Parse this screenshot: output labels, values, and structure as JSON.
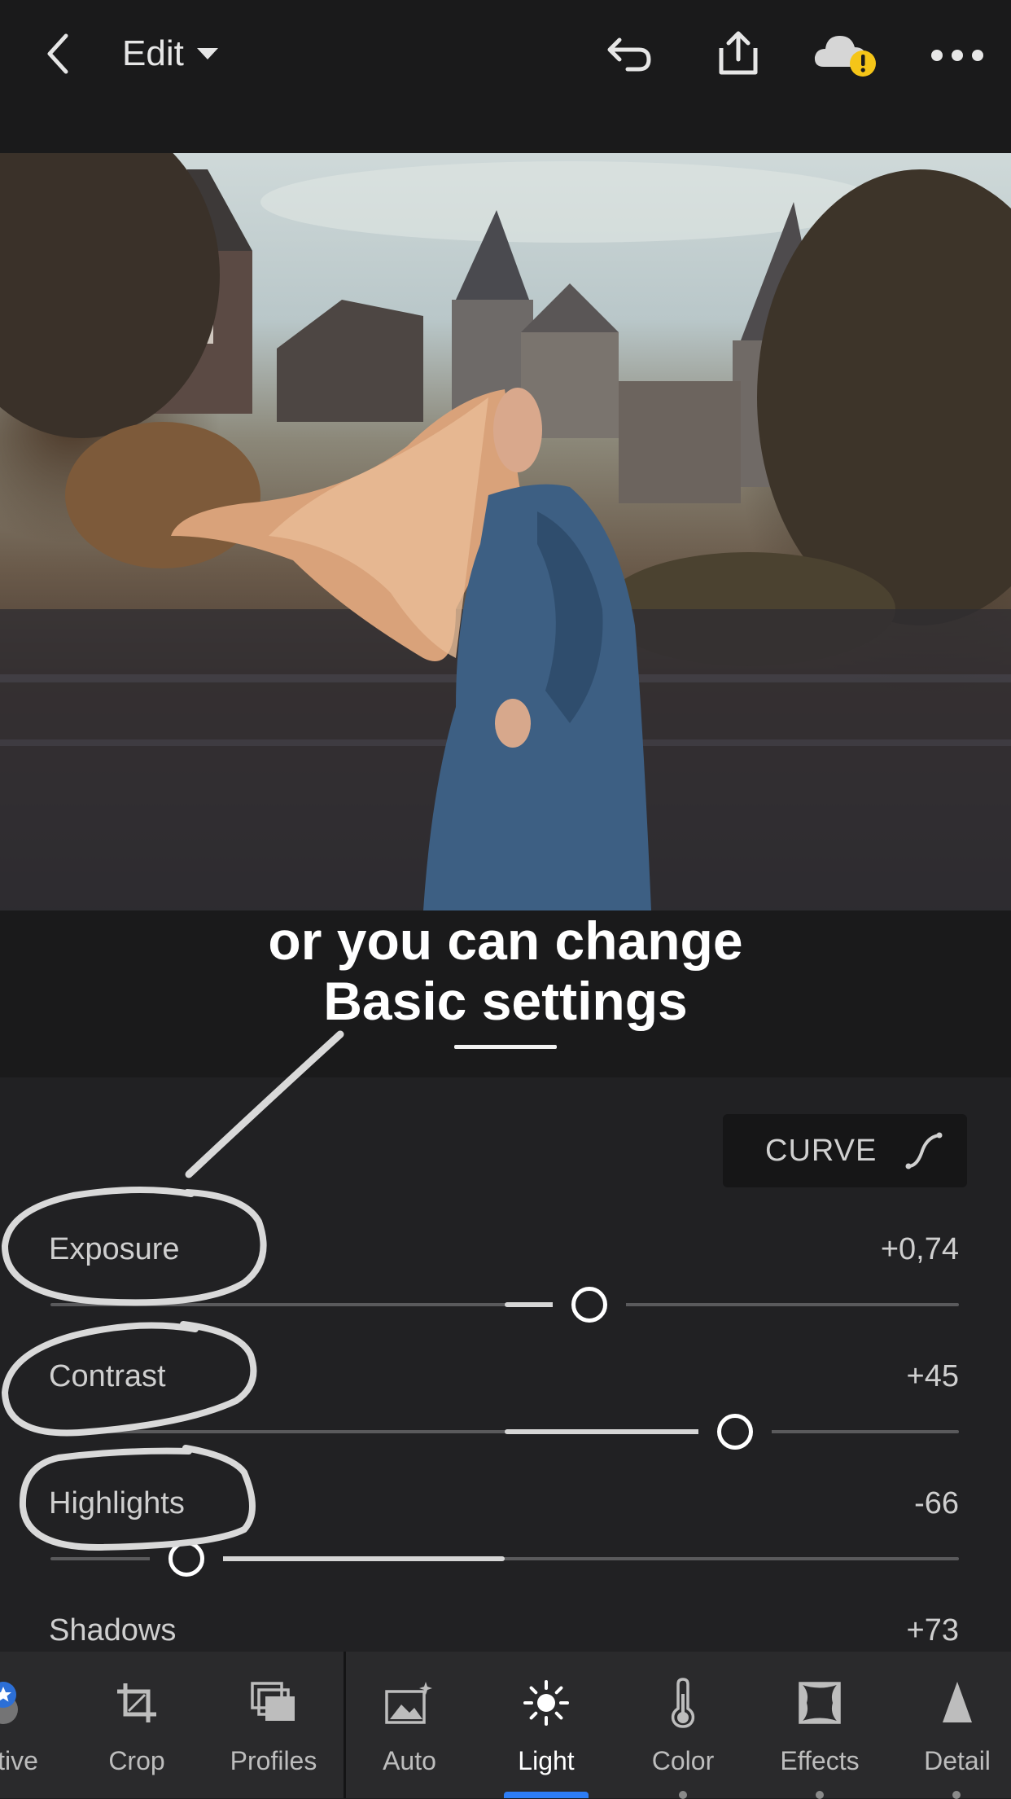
{
  "topbar": {
    "back_icon": "chevron-left-icon",
    "edit_label": "Edit",
    "dropdown_icon": "caret-down-icon",
    "undo_icon": "undo-icon",
    "share_icon": "share-icon",
    "cloud_icon": "cloud-warning-icon",
    "more_icon": "more-dots-icon"
  },
  "photo": {
    "description_icon": "photo"
  },
  "caption": {
    "line1": "or you can change",
    "line2": "Basic settings"
  },
  "curve_button": {
    "label": "CURVE",
    "icon": "curve-icon"
  },
  "sliders": [
    {
      "label": "Exposure",
      "value": "+0,74",
      "fraction": 0.593
    },
    {
      "label": "Contrast",
      "value": "+45",
      "fraction": 0.754
    },
    {
      "label": "Highlights",
      "value": "-66",
      "fraction": 0.15
    },
    {
      "label": "Shadows",
      "value": "+73"
    }
  ],
  "toolbar": [
    {
      "label": "ctive",
      "icon": "selective-icon"
    },
    {
      "label": "Crop",
      "icon": "crop-icon"
    },
    {
      "label": "Profiles",
      "icon": "profiles-icon"
    },
    {
      "label": "Auto",
      "icon": "auto-icon"
    },
    {
      "label": "Light",
      "icon": "sun-icon",
      "active": true
    },
    {
      "label": "Color",
      "icon": "thermometer-icon"
    },
    {
      "label": "Effects",
      "icon": "effects-icon"
    },
    {
      "label": "Detail",
      "icon": "detail-icon"
    }
  ],
  "colors": {
    "accent": "#2d7df6",
    "warning": "#f5c518",
    "selective_badge": "#2c6fd6"
  }
}
